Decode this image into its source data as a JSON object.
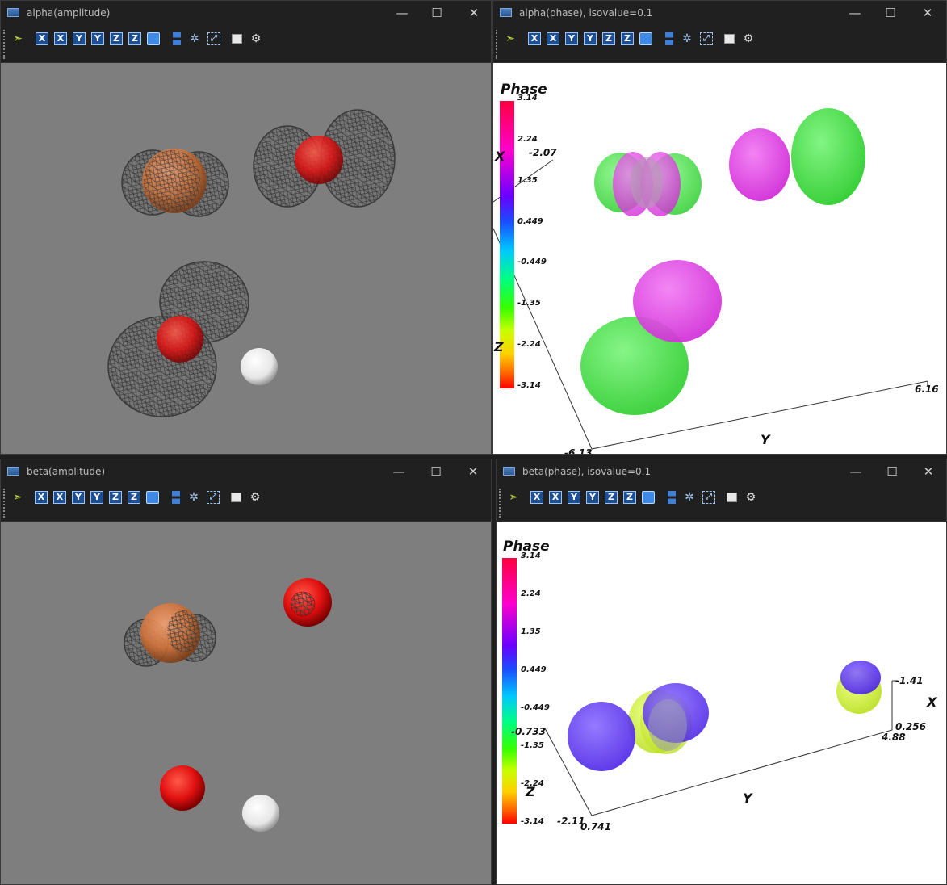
{
  "windows": [
    {
      "title": "alpha(amplitude)"
    },
    {
      "title": "alpha(phase), isovalue=0.1"
    },
    {
      "title": "beta(amplitude)"
    },
    {
      "title": "beta(phase), isovalue=0.1"
    }
  ],
  "controls": {
    "minimize": "—",
    "maximize": "☐",
    "close": "✕"
  },
  "toolbar": {
    "items": [
      "pick-icon",
      "X",
      "X",
      "Y",
      "Y",
      "Z",
      "Z",
      "cube-icon",
      "split-icon",
      "spark-icon",
      "fit-icon",
      "screenshot-icon",
      "gear-icon"
    ],
    "axis_labels": [
      "X",
      "X",
      "Y",
      "Y",
      "Z",
      "Z"
    ]
  },
  "colorbar": {
    "title": "Phase",
    "ticks": [
      "3.14",
      "2.24",
      "1.35",
      "0.449",
      "-0.449",
      "-1.35",
      "-2.24",
      "-3.14"
    ],
    "colors": [
      "#ff0040",
      "#ff00cc",
      "#6a00ff",
      "#1a4dff",
      "#00c8ff",
      "#00ff80",
      "#c8ff00",
      "#ff0000"
    ]
  },
  "alpha_phase_axes": {
    "x_label": "X",
    "y_label": "Y",
    "z_label": "Z",
    "x_value": "-2.07",
    "y_end": "6.16",
    "origin_value": "-6.13"
  },
  "beta_phase_axes": {
    "x_label": "X",
    "y_label": "Y",
    "z_label": "Z",
    "x_top": "-1.41",
    "x_bottom": "0.256",
    "y_end": "4.88",
    "z_top": "-0.733",
    "origin_left": "-2.11",
    "origin_right": "0.741"
  },
  "colors": {
    "window_bg": "#202020",
    "gray_view": "#7e7e7e",
    "white_view": "#ffffff",
    "oxygen": "#e01010",
    "metal": "#d2733a",
    "hydrogen": "#f2f2f2",
    "phase_positive": "#e040e8",
    "phase_negative": "#40e040",
    "beta_positive": "#6644ee",
    "beta_negative": "#ccee33"
  }
}
